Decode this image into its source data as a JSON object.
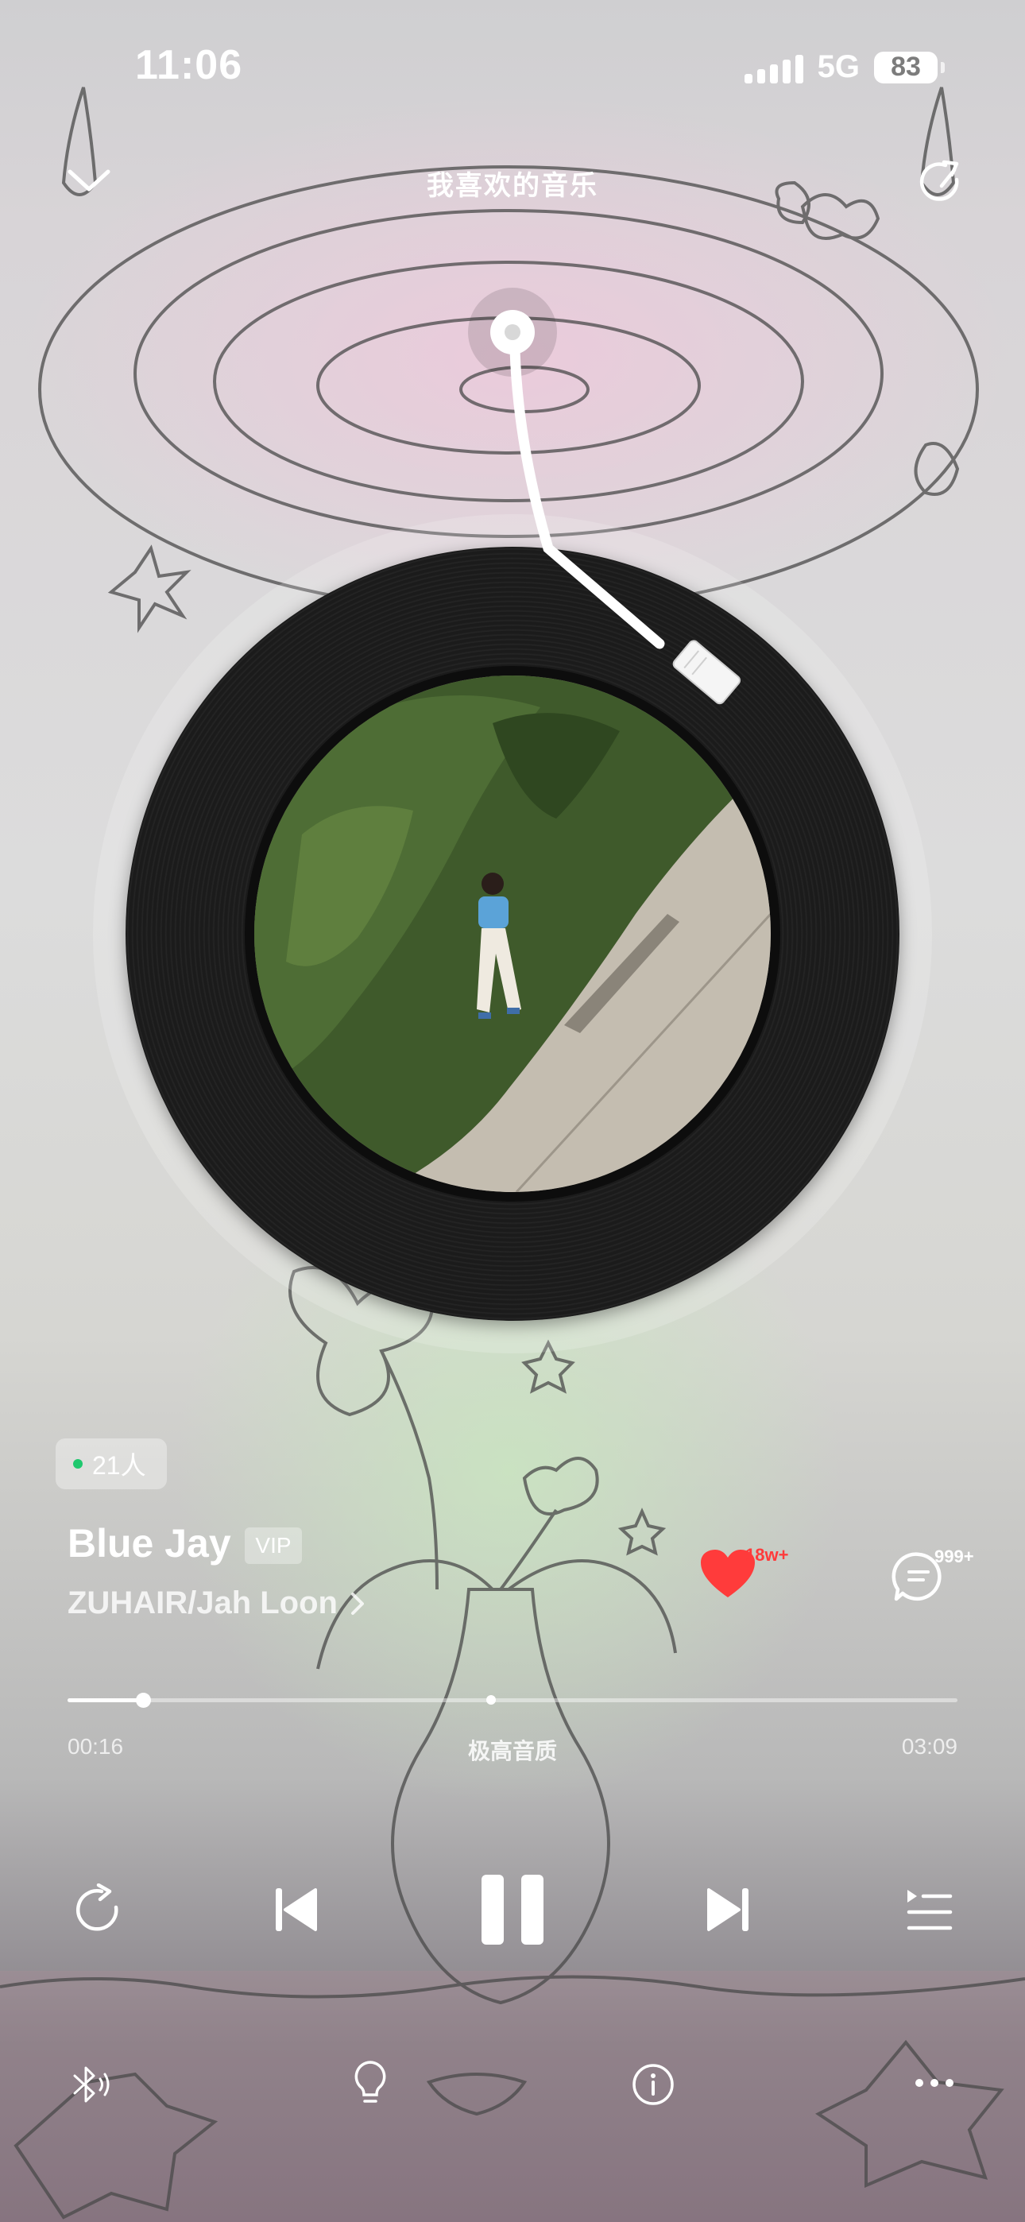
{
  "status_bar": {
    "time": "11:06",
    "network": "5G",
    "battery": "83"
  },
  "header": {
    "title": "我喜欢的音乐"
  },
  "listeners": {
    "label": "21人",
    "dot_color": "#1fc86e"
  },
  "song": {
    "title": "Blue Jay",
    "badge": "VIP",
    "artist": "ZUHAIR/Jah Loon",
    "liked": true,
    "like_count": "18w+",
    "comment_count": "999+"
  },
  "playback": {
    "elapsed": "00:16",
    "duration": "03:09",
    "progress_fraction": 0.085,
    "quality": "极高音质",
    "is_playing": true
  },
  "icons": {
    "top_left": "chevron-down-icon",
    "top_right": "share-icon",
    "repeat": "repeat-icon",
    "previous": "previous-icon",
    "pause": "pause-icon",
    "next": "next-icon",
    "playlist": "playlist-icon",
    "bluetooth": "bluetooth-audio-icon",
    "tip": "lightbulb-icon",
    "info": "info-icon",
    "more": "more-icon",
    "like": "heart-icon",
    "comment": "comment-icon"
  },
  "colors": {
    "accent_like": "#ff3b3b",
    "text": "#ffffff"
  }
}
